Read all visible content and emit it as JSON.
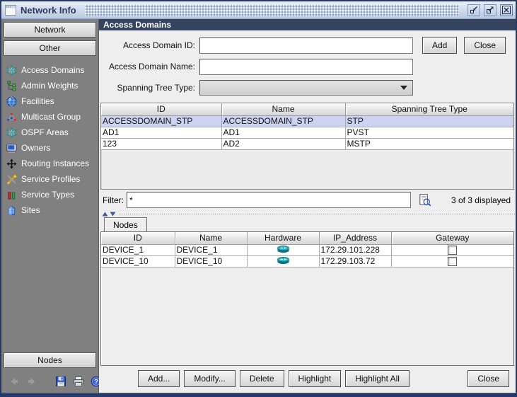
{
  "colors": {
    "titlebar_blue": "#bccbe2",
    "frame_border": "#24396a",
    "section_header_bg": "#36435f",
    "sidebar_bg": "#808080",
    "selected_row_bg": "#ccd3f0"
  },
  "window": {
    "title": "Network Info",
    "controls": [
      {
        "name": "iconify"
      },
      {
        "name": "maximize"
      },
      {
        "name": "close"
      }
    ]
  },
  "sidebar": {
    "buttons": [
      {
        "label": "Network"
      },
      {
        "label": "Other"
      }
    ],
    "items": [
      {
        "label": "Access Domains",
        "icon": "network-star-icon"
      },
      {
        "label": "Admin Weights",
        "icon": "tree-icon"
      },
      {
        "label": "Facilities",
        "icon": "globe-icon"
      },
      {
        "label": "Multicast Group",
        "icon": "multicast-icon"
      },
      {
        "label": "OSPF Areas",
        "icon": "network-star-icon"
      },
      {
        "label": "Owners",
        "icon": "monitor-icon"
      },
      {
        "label": "Routing Instances",
        "icon": "move-cross-icon"
      },
      {
        "label": "Service Profiles",
        "icon": "tools-icon"
      },
      {
        "label": "Service Types",
        "icon": "service-flasks-icon"
      },
      {
        "label": "Sites",
        "icon": "building-icon"
      }
    ],
    "nodes_button": {
      "label": "Nodes"
    },
    "toolbar": [
      {
        "name": "back"
      },
      {
        "name": "forward"
      },
      {
        "name": "save"
      },
      {
        "name": "print"
      },
      {
        "name": "help"
      }
    ]
  },
  "main": {
    "section_header": "Access Domains",
    "form": {
      "fields": [
        {
          "label": "Access Domain ID:",
          "value": "",
          "type": "text"
        },
        {
          "label": "Access Domain Name:",
          "value": "",
          "type": "text"
        },
        {
          "label": "Spanning Tree Type:",
          "value": "",
          "type": "select"
        }
      ],
      "add_button": "Add",
      "close_button": "Close"
    },
    "domains_table": {
      "columns": [
        "ID",
        "Name",
        "Spanning Tree Type"
      ],
      "rows": [
        {
          "cells": [
            "ACCESSDOMAIN_STP",
            "ACCESSDOMAIN_STP",
            "STP"
          ],
          "selected": true
        },
        {
          "cells": [
            "AD1",
            "AD1",
            "PVST"
          ],
          "selected": false
        },
        {
          "cells": [
            "123",
            "AD2",
            "MSTP"
          ],
          "selected": false
        }
      ]
    },
    "filter": {
      "label": "Filter:",
      "value": "*",
      "icon": "preview-search-icon",
      "status": "3 of 3 displayed"
    },
    "tabs": [
      {
        "label": "Nodes",
        "selected": true
      }
    ],
    "nodes_table": {
      "columns": [
        "ID",
        "Name",
        "Hardware",
        "IP_Address",
        "Gateway"
      ],
      "rows": [
        {
          "id": "DEVICE_1",
          "name": "DEVICE_1",
          "hardware_icon": "router-icon",
          "ip": "172.29.101.228",
          "gateway_checked": false
        },
        {
          "id": "DEVICE_10",
          "name": "DEVICE_10",
          "hardware_icon": "router-icon",
          "ip": "172.29.103.72",
          "gateway_checked": false
        }
      ]
    },
    "action_buttons": [
      "Add...",
      "Modify...",
      "Delete",
      "Highlight",
      "Highlight All"
    ],
    "close_button": "Close"
  }
}
